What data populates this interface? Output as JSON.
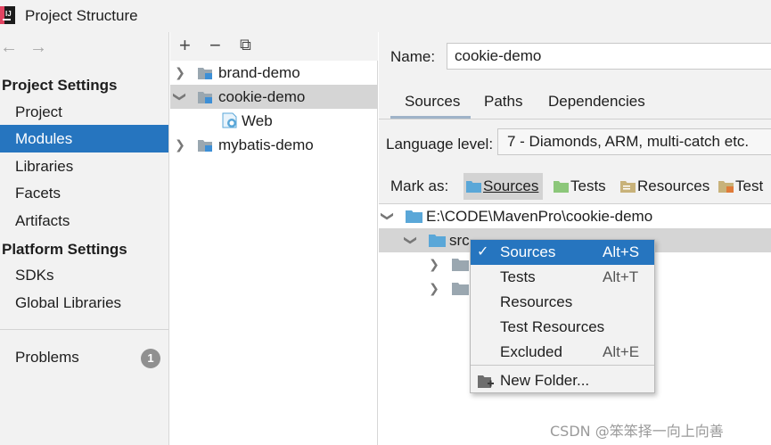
{
  "window": {
    "title": "Project Structure"
  },
  "nav": {
    "back": "←",
    "forward": "→"
  },
  "sidebar": {
    "project_settings_header": "Project Settings",
    "project_items": [
      "Project",
      "Modules",
      "Libraries",
      "Facets",
      "Artifacts"
    ],
    "platform_settings_header": "Platform Settings",
    "platform_items": [
      "SDKs",
      "Global Libraries"
    ],
    "problems": {
      "label": "Problems",
      "count": "1"
    },
    "selected": "Modules"
  },
  "modules_toolbar": {
    "add": "+",
    "remove": "−",
    "copy": "⧉"
  },
  "modules_tree": [
    {
      "label": "brand-demo",
      "expanded": false
    },
    {
      "label": "cookie-demo",
      "expanded": true,
      "selected": true
    },
    {
      "label": "Web",
      "child": true
    },
    {
      "label": "mybatis-demo",
      "expanded": false
    }
  ],
  "details": {
    "name_label": "Name:",
    "name_value": "cookie-demo",
    "tabs": [
      "Sources",
      "Paths",
      "Dependencies"
    ],
    "active_tab": "Sources",
    "language_level_label": "Language level:",
    "language_level_value": "7 - Diamonds, ARM, multi-catch etc.",
    "mark_as_label": "Mark as:",
    "mark_as_buttons": [
      "Sources",
      "Tests",
      "Resources",
      "Test R"
    ],
    "content_root": "E:\\CODE\\MavenPro\\cookie-demo",
    "src_folder": "src"
  },
  "context_menu": {
    "items": [
      {
        "label": "Sources",
        "shortcut": "Alt+S",
        "checked": true,
        "selected": true
      },
      {
        "label": "Tests",
        "shortcut": "Alt+T"
      },
      {
        "label": "Resources",
        "shortcut": ""
      },
      {
        "label": "Test Resources",
        "shortcut": ""
      },
      {
        "label": "Excluded",
        "shortcut": "Alt+E"
      }
    ],
    "check_mark": "✓",
    "new_folder": "New Folder..."
  },
  "colors": {
    "selection_blue": "#2675bf",
    "panel_gray": "#f2f2f2",
    "folder_blue": "#5aa7d8",
    "folder_green": "#8cc77a",
    "folder_resources": "#c8b27a"
  },
  "watermark": "CSDN @笨笨择一向上向善"
}
